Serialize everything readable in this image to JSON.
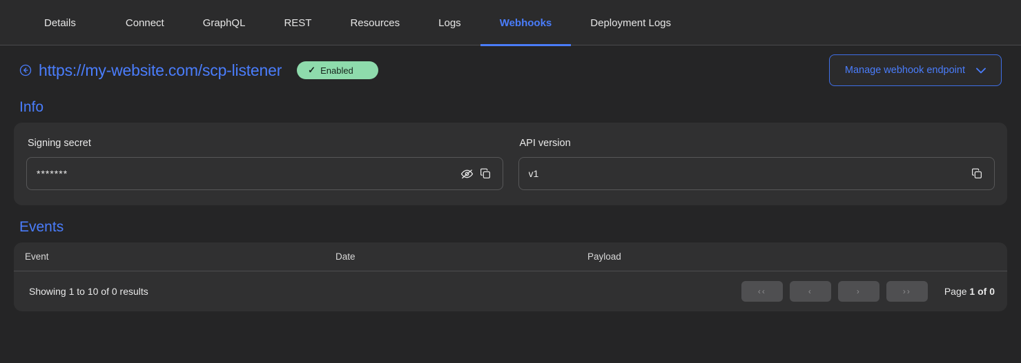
{
  "top_action": {
    "label": ""
  },
  "tabs": [
    {
      "label": "Details",
      "active": false
    },
    {
      "label": "Connect",
      "active": false
    },
    {
      "label": "GraphQL",
      "active": false
    },
    {
      "label": "REST",
      "active": false
    },
    {
      "label": "Resources",
      "active": false
    },
    {
      "label": "Logs",
      "active": false
    },
    {
      "label": "Webhooks",
      "active": true
    },
    {
      "label": "Deployment Logs",
      "active": false
    }
  ],
  "header": {
    "back_icon": "arrow-left-circle-icon",
    "url": "https://my-website.com/scp-listener",
    "status_badge": {
      "check": "✓",
      "label": "Enabled"
    },
    "manage_button": {
      "label": "Manage webhook endpoint",
      "chevron": "chevron-down-icon"
    }
  },
  "info": {
    "title": "Info",
    "signing_secret": {
      "label": "Signing secret",
      "value": "*******",
      "hide_icon": "eye-off-icon",
      "copy_icon": "copy-icon"
    },
    "api_version": {
      "label": "API version",
      "value": "v1",
      "copy_icon": "copy-icon"
    }
  },
  "events": {
    "title": "Events",
    "columns": [
      "Event",
      "Date",
      "Payload"
    ],
    "rows": [],
    "footer": {
      "showing": "Showing 1 to 10 of 0 results",
      "pager": {
        "first": "‹‹",
        "prev": "‹",
        "next": "›",
        "last": "››"
      },
      "page_prefix": "Page ",
      "page_value": "1 of 0"
    }
  },
  "colors": {
    "page_bg": "#252526",
    "card_bg": "#303031",
    "tabbar_bg": "#2b2b2c",
    "accent_blue": "#4a7dfc",
    "badge_green": "#8edbac",
    "border": "#575758"
  }
}
